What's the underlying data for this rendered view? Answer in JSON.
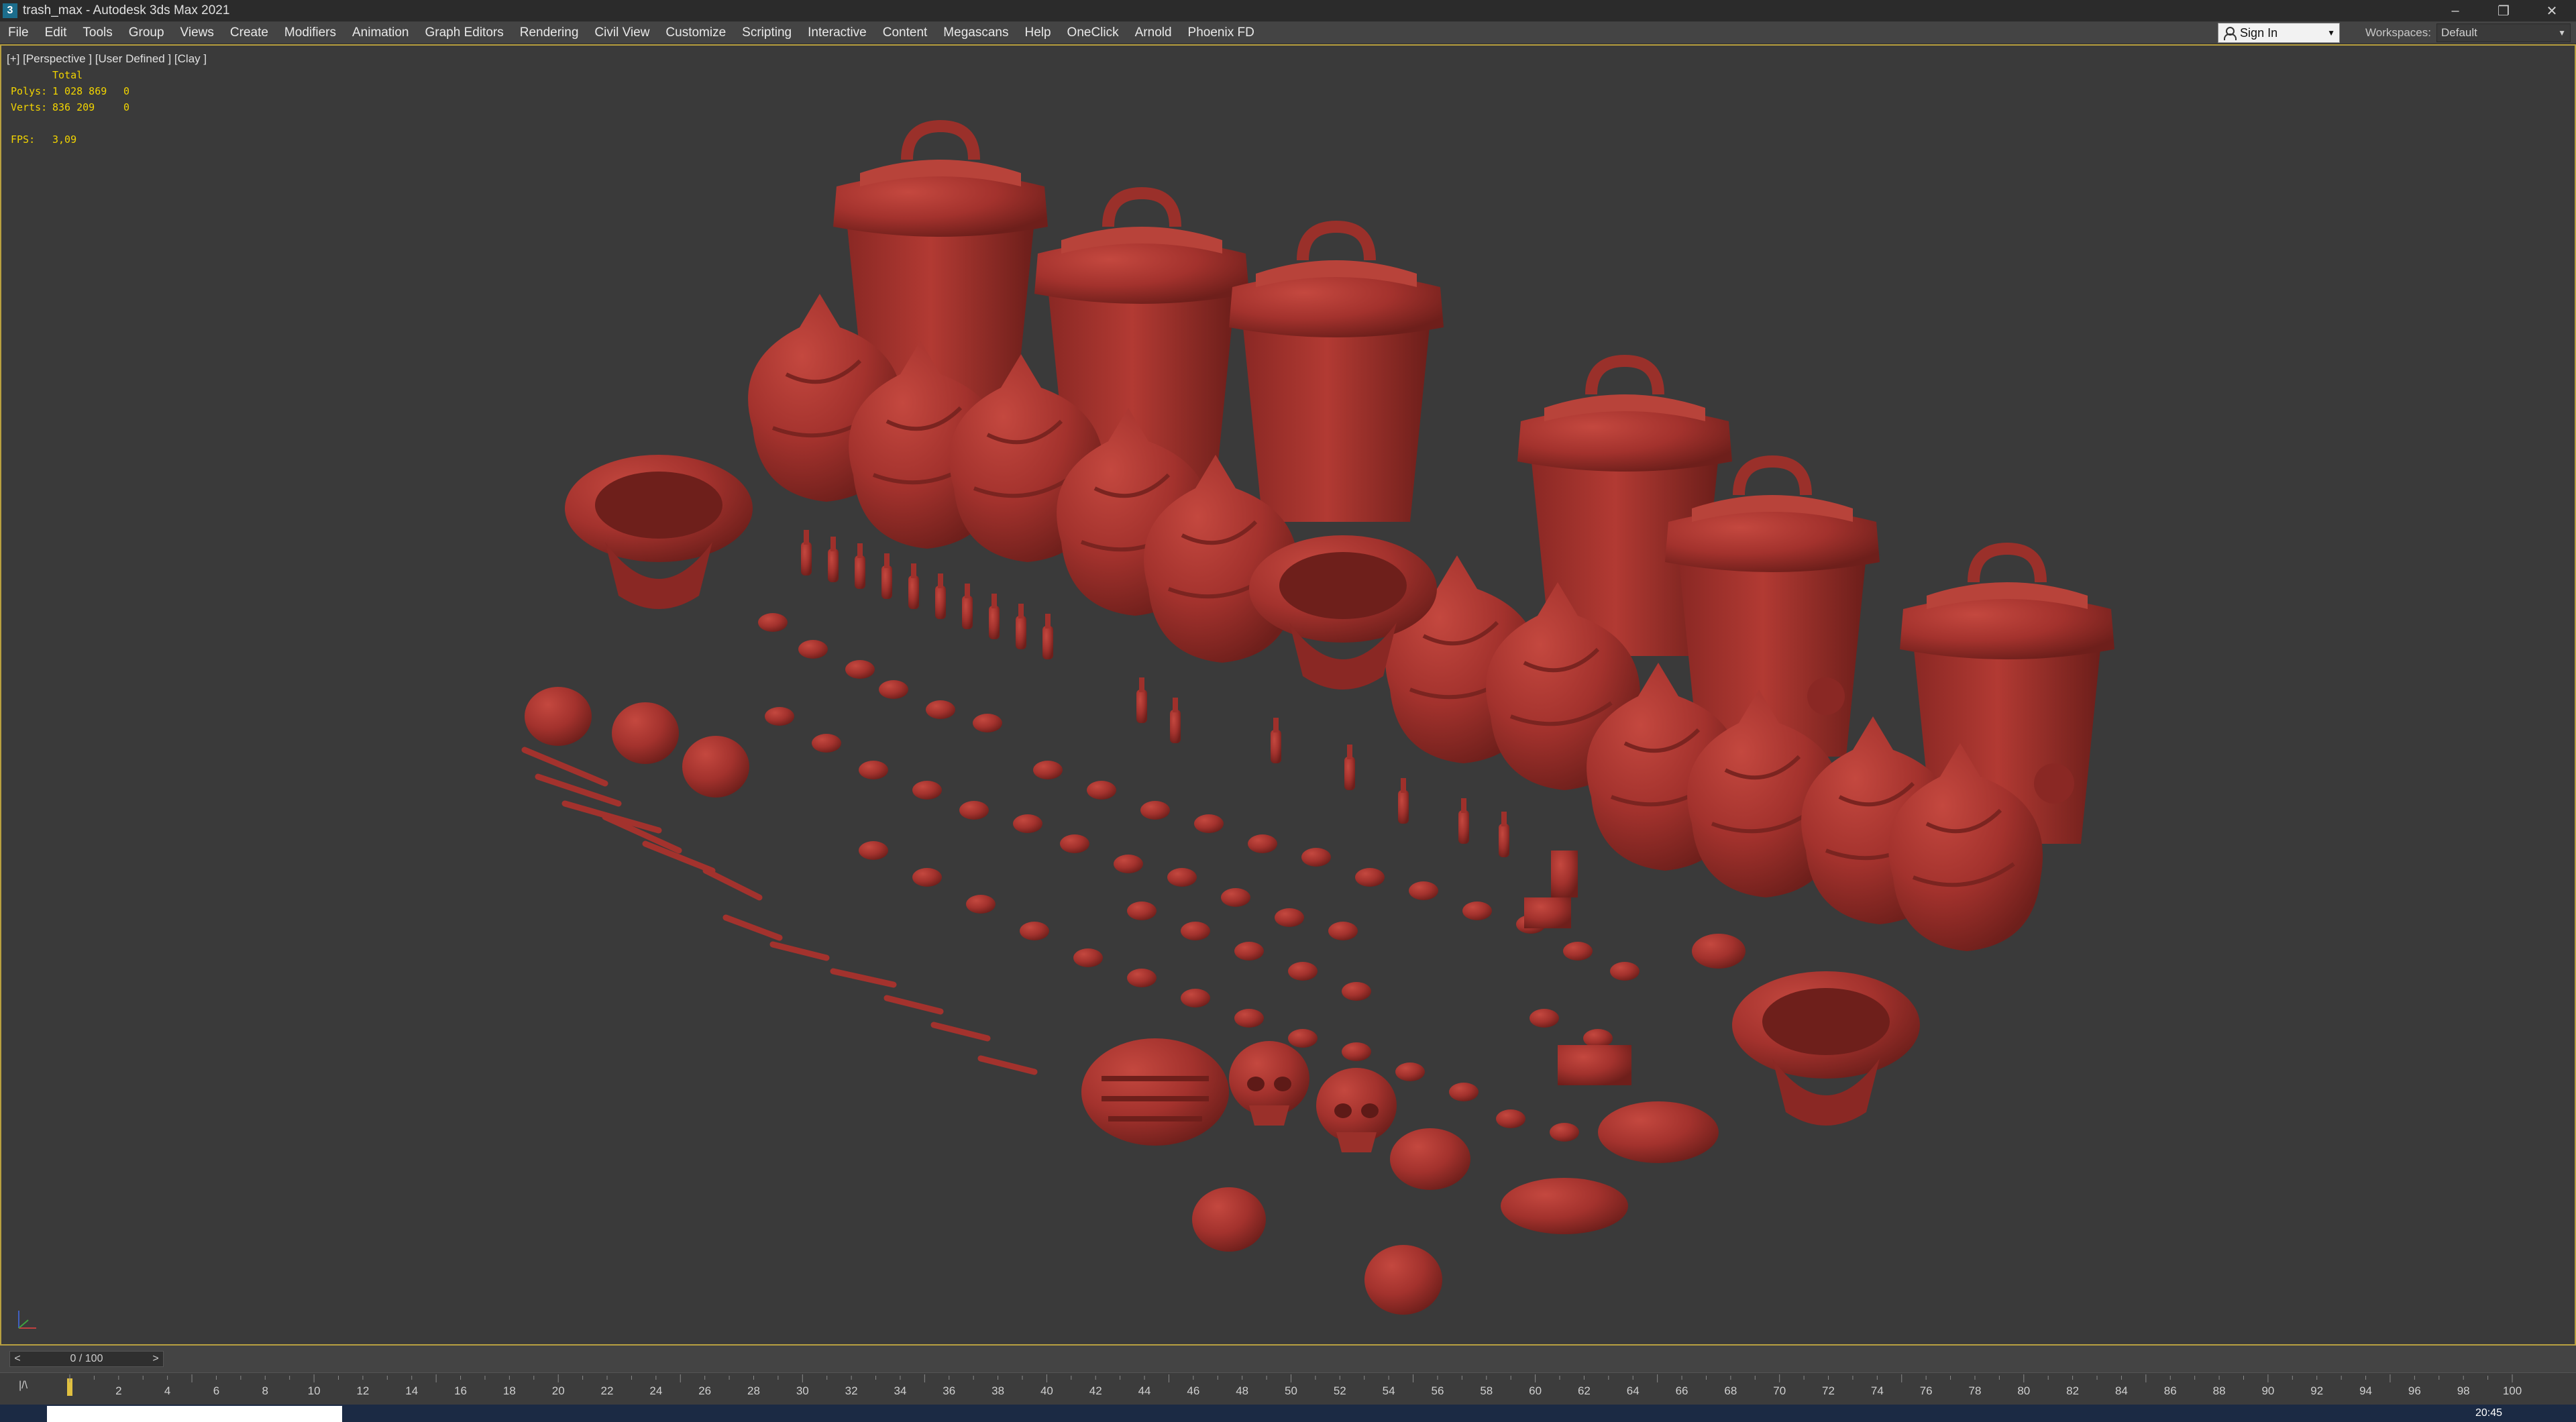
{
  "window": {
    "title": "trash_max - Autodesk 3ds Max 2021",
    "app_icon": "3",
    "controls": {
      "minimize": "–",
      "restore": "❐",
      "close": "✕"
    }
  },
  "menu": {
    "items": [
      "File",
      "Edit",
      "Tools",
      "Group",
      "Views",
      "Create",
      "Modifiers",
      "Animation",
      "Graph Editors",
      "Rendering",
      "Civil View",
      "Customize",
      "Scripting",
      "Interactive",
      "Content",
      "Megascans",
      "Help",
      "OneClick",
      "Arnold",
      "Phoenix FD"
    ],
    "sign_in": "Sign In",
    "workspaces_label": "Workspaces:",
    "workspace_value": "Default"
  },
  "viewport": {
    "label": "[+] [Perspective ] [User Defined ] [Clay ]",
    "stats": {
      "header": "Total",
      "polys_label": "Polys:",
      "polys_value": "1 028 869",
      "polys_sel": "0",
      "verts_label": "Verts:",
      "verts_value": "836 209",
      "verts_sel": "0",
      "fps_label": "FPS:",
      "fps_value": "3,09"
    },
    "clay_color": "#a3322d",
    "bg_color": "#3a3a3a"
  },
  "timeline": {
    "slider_text": "0 / 100",
    "prev": "<",
    "next": ">",
    "key_icon_text": "|/\\",
    "ticks": [
      "2",
      "4",
      "6",
      "8",
      "10",
      "12",
      "14",
      "16",
      "18",
      "20",
      "22",
      "24",
      "26",
      "28",
      "30",
      "32",
      "34",
      "36",
      "38",
      "40",
      "42",
      "44",
      "46",
      "48",
      "50",
      "52",
      "54",
      "56",
      "58",
      "60",
      "62",
      "64",
      "66",
      "68",
      "70",
      "72",
      "74",
      "76",
      "78",
      "80",
      "82",
      "84",
      "86",
      "88",
      "90",
      "92",
      "94",
      "96",
      "98",
      "100"
    ]
  },
  "taskbar": {
    "clock": "20:45"
  }
}
